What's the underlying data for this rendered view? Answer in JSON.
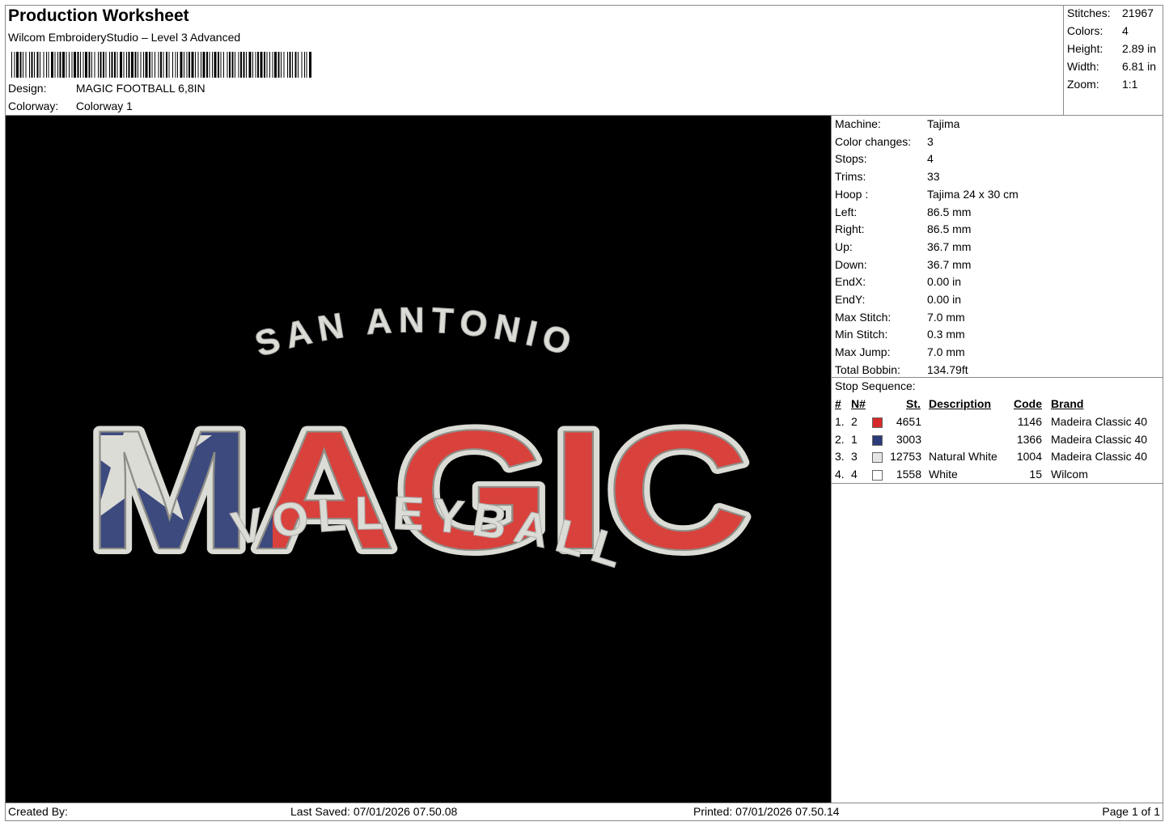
{
  "header": {
    "title": "Production Worksheet",
    "software": "Wilcom EmbroideryStudio – Level 3 Advanced",
    "design_label": "Design:",
    "design_value": "MAGIC FOOTBALL 6,8IN",
    "colorway_label": "Colorway:",
    "colorway_value": "Colorway 1"
  },
  "summary": {
    "stitches_label": "Stitches:",
    "stitches_value": "21967",
    "colors_label": "Colors:",
    "colors_value": "4",
    "height_label": "Height:",
    "height_value": "2.89 in",
    "width_label": "Width:",
    "width_value": "6.81 in",
    "zoom_label": "Zoom:",
    "zoom_value": "1:1"
  },
  "machine_info": [
    {
      "label": "Machine:",
      "value": "Tajima"
    },
    {
      "label": "Color changes:",
      "value": "3"
    },
    {
      "label": "Stops:",
      "value": "4"
    },
    {
      "label": "Trims:",
      "value": "33"
    },
    {
      "label": "Hoop :",
      "value": "Tajima 24 x 30 cm"
    },
    {
      "label": "Left:",
      "value": "86.5 mm"
    },
    {
      "label": "Right:",
      "value": "86.5 mm"
    },
    {
      "label": "Up:",
      "value": "36.7 mm"
    },
    {
      "label": "Down:",
      "value": "36.7 mm"
    },
    {
      "label": "EndX:",
      "value": "0.00 in"
    },
    {
      "label": "EndY:",
      "value": "0.00 in"
    },
    {
      "label": "Max Stitch:",
      "value": "7.0 mm"
    },
    {
      "label": "Min Stitch:",
      "value": "0.3 mm"
    },
    {
      "label": "Max Jump:",
      "value": "7.0 mm"
    },
    {
      "label": "Total Bobbin:",
      "value": "134.79ft"
    }
  ],
  "stop_sequence": {
    "title": "Stop Sequence:",
    "headers": {
      "num": "#",
      "n": "N#",
      "st": "St.",
      "description": "Description",
      "code": "Code",
      "brand": "Brand"
    },
    "rows": [
      {
        "num": "1.",
        "n": "2",
        "color": "#d62a2a",
        "st": "4651",
        "description": "",
        "code": "1146",
        "brand": "Madeira Classic 40"
      },
      {
        "num": "2.",
        "n": "1",
        "color": "#2b3a78",
        "st": "3003",
        "description": "",
        "code": "1366",
        "brand": "Madeira Classic 40"
      },
      {
        "num": "3.",
        "n": "3",
        "color": "#e6e6e6",
        "st": "12753",
        "description": "Natural White",
        "code": "1004",
        "brand": "Madeira Classic 40"
      },
      {
        "num": "4.",
        "n": "4",
        "color": "#ffffff",
        "st": "1558",
        "description": "White",
        "code": "15",
        "brand": "Wilcom"
      }
    ]
  },
  "design_text": {
    "top": "SAN ANTONIO",
    "main": "MAGIC",
    "bottom": "VOLLEYBALL"
  },
  "colors": {
    "red": "#d9413c",
    "navy": "#3d4a7e",
    "white": "#dcdcd6",
    "background": "#000000"
  },
  "footer": {
    "created_by": "Created By:",
    "last_saved": "Last Saved: 07/01/2026 07.50.08",
    "printed": "Printed: 07/01/2026 07.50.14",
    "page": "Page 1 of 1"
  }
}
